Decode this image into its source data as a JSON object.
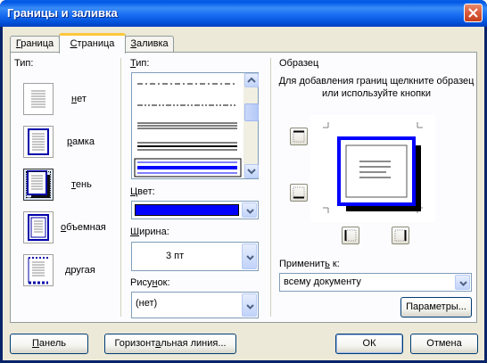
{
  "window": {
    "title": "Границы и заливка"
  },
  "tabs": [
    {
      "label": "Граница",
      "ul": "Г",
      "rest": "раница"
    },
    {
      "label": "Страница",
      "ul": "С",
      "rest": "траница"
    },
    {
      "label": "Заливка",
      "ul": "З",
      "rest": "аливка"
    }
  ],
  "settings": {
    "label": "Тип:",
    "items": [
      {
        "label": "нет",
        "ul": "н",
        "rest": "ет"
      },
      {
        "label": "рамка",
        "ul": "р",
        "rest": "амка"
      },
      {
        "label": "тень",
        "ul": "т",
        "rest": "ень"
      },
      {
        "label": "объемная",
        "ul": "о",
        "rest": "бъемная"
      },
      {
        "label": "другая",
        "ul": "д",
        "rest": "ругая"
      }
    ],
    "selected": "тень"
  },
  "style": {
    "label": "Тип:",
    "color_label": "Цвет:",
    "color_value": "#0000ff",
    "width_label": "Ширина:",
    "width_value": "3 пт",
    "art_label": "Рисунок:",
    "art_value": "(нет)"
  },
  "preview": {
    "label": "Образец",
    "hint": "Для добавления границ щелкните образец или используйте кнопки",
    "apply_label": "Применить к:",
    "apply_value": "всему документу",
    "options_button": "Параметры..."
  },
  "footer": {
    "panel_button": "Панель",
    "hline_button": "Горизонтальная линия...",
    "ok_button": "ОК",
    "cancel_button": "Отмена"
  },
  "colors": {
    "border": "#0000ff",
    "shadow": "#000000"
  }
}
